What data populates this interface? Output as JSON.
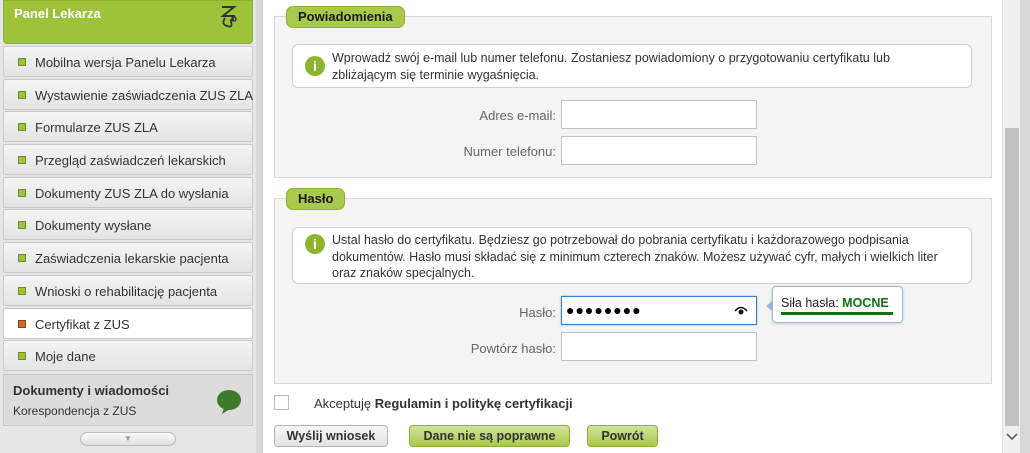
{
  "sidebar": {
    "title": "Panel Lekarza",
    "title_icon": "stethoscope-icon",
    "items": [
      {
        "label": "Mobilna wersja Panelu Lekarza"
      },
      {
        "label": "Wystawienie zaświadczenia ZUS ZLA"
      },
      {
        "label": "Formularze ZUS ZLA"
      },
      {
        "label": "Przegląd zaświadczeń lekarskich"
      },
      {
        "label": "Dokumenty ZUS ZLA do wysłania"
      },
      {
        "label": "Dokumenty wysłane"
      },
      {
        "label": "Zaświadczenia lekarskie pacjenta"
      },
      {
        "label": "Wnioski o rehabilitację pacjenta"
      },
      {
        "label": "Certyfikat z ZUS",
        "active": true
      },
      {
        "label": "Moje dane"
      }
    ],
    "docs_title": "Dokumenty i wiadomości",
    "docs_subtitle": "Korespondencja z ZUS",
    "docs_icon": "speech-bubble-icon",
    "scroll_glyph": "▼"
  },
  "notifications": {
    "tag": "Powiadomienia",
    "info_icon": "i",
    "info": "Wprowadź swój e-mail lub numer telefonu. Zostaniesz powiadomiony o przygotowaniu certyfikatu lub zbliżającym się terminie wygaśnięcia.",
    "email_label": "Adres e-mail:",
    "email_value": "",
    "phone_label": "Numer telefonu:",
    "phone_value": ""
  },
  "password": {
    "tag": "Hasło",
    "info_icon": "i",
    "info": "Ustal hasło do certyfikatu. Będziesz go potrzebował do pobrania certyfikatu i każdorazowego podpisania dokumentów. Hasło musi składać się z minimum czterech znaków. Możesz używać cyfr, małych i wielkich liter oraz znaków specjalnych.",
    "password_label": "Hasło:",
    "password_value": "●●●●●●●●",
    "repeat_label": "Powtórz hasło:",
    "repeat_value": "",
    "strength_label": "Siła hasła: ",
    "strength_value": "MOCNE",
    "strength_color": "#137013"
  },
  "accept": {
    "prefix": "Akceptuję ",
    "link": "Regulamin i politykę certyfikacji"
  },
  "buttons": {
    "send": "Wyślij wniosek",
    "incorrect": "Dane nie są poprawne",
    "back": "Powrót"
  },
  "colors": {
    "accent": "#a9c94d",
    "header": "#9dc33b"
  }
}
